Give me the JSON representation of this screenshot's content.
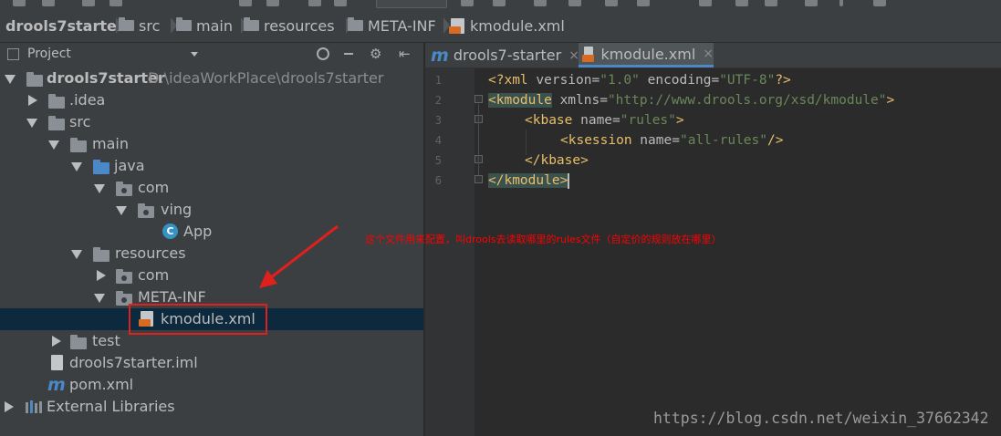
{
  "breadcrumb": {
    "items": [
      {
        "label": "drools7starter"
      },
      {
        "label": "src"
      },
      {
        "label": "main"
      },
      {
        "label": "resources"
      },
      {
        "label": "META-INF"
      },
      {
        "label": "kmodule.xml"
      }
    ]
  },
  "project_panel": {
    "title": "Project",
    "tree": [
      {
        "label": "drools7starter",
        "path": "D:\\ideaWorkPlace\\drools7starter"
      },
      {
        "label": ".idea"
      },
      {
        "label": "src"
      },
      {
        "label": "main"
      },
      {
        "label": "java"
      },
      {
        "label": "com"
      },
      {
        "label": "ving"
      },
      {
        "label": "App"
      },
      {
        "label": "resources"
      },
      {
        "label": "com"
      },
      {
        "label": "META-INF"
      },
      {
        "label": "kmodule.xml"
      },
      {
        "label": "test"
      },
      {
        "label": "drools7starter.iml"
      },
      {
        "label": "pom.xml"
      },
      {
        "label": "External Libraries"
      }
    ]
  },
  "editor": {
    "tabs": [
      {
        "label": "drools7-starter",
        "close": "×"
      },
      {
        "label": "kmodule.xml",
        "close": "×"
      }
    ],
    "line_numbers": [
      "1",
      "2",
      "3",
      "4",
      "5",
      "6"
    ],
    "lines": {
      "l1": {
        "open": "<?xml ",
        "a1": "version=",
        "v1": "\"1.0\"",
        "a2": " encoding=",
        "v2": "\"UTF-8\"",
        "close": "?>"
      },
      "l2": {
        "tag": "<kmodule",
        "a1": " xmlns=",
        "v1": "\"http://www.drools.org/xsd/kmodule\"",
        "close": ">"
      },
      "l3": {
        "tag": "<kbase",
        "a1": " name=",
        "v1": "\"rules\"",
        "close": ">"
      },
      "l4": {
        "tag": "<ksession",
        "a1": " name=",
        "v1": "\"all-rules\"",
        "close": "/>"
      },
      "l5": {
        "tag": "</kbase>"
      },
      "l6": {
        "tag": "</kmodule>"
      }
    }
  },
  "annotation": {
    "text": "这个文件用来配置，叫drools去读取哪里的rules文件（自定价的规则放在哪里）"
  },
  "watermark": "https://blog.csdn.net/weixin_37662342",
  "colors": {
    "accent": "#4a88c7",
    "annotation": "#ff0000",
    "selection": "#0d293e"
  }
}
